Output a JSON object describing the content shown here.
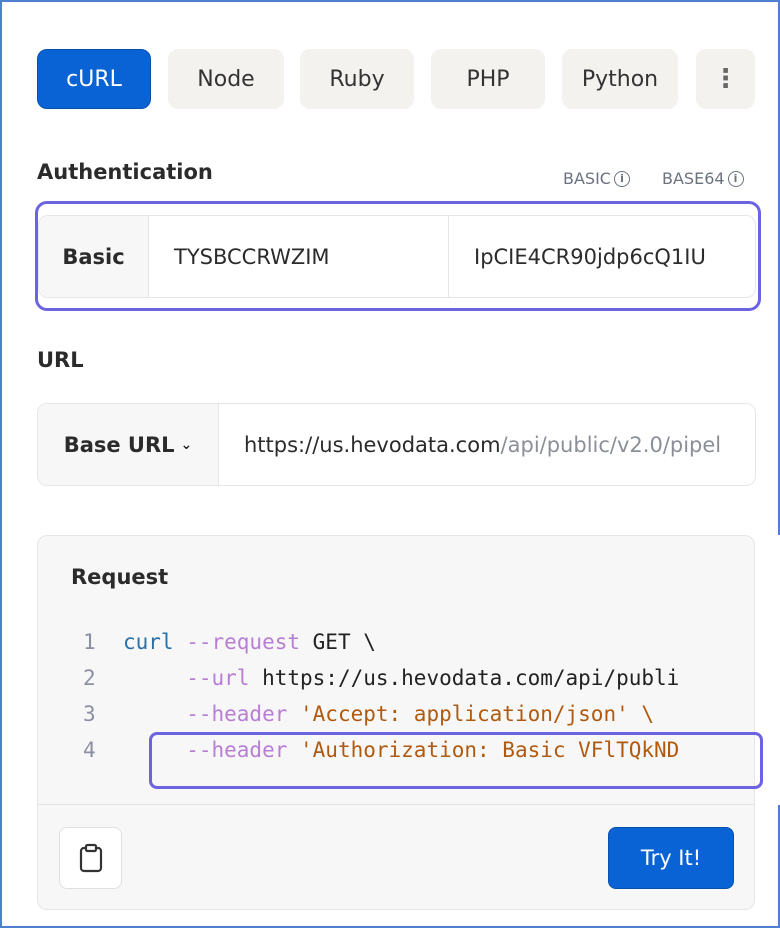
{
  "tabs": [
    "cURL",
    "Node",
    "Ruby",
    "PHP",
    "Python"
  ],
  "more_icon": "kebab-vertical-icon",
  "auth": {
    "title": "Authentication",
    "basic_label": "BASIC",
    "base64_label": "BASE64",
    "type": "Basic",
    "username": "TYSBCCRWZIM",
    "password": "IpCIE4CR90jdp6cQ1IU"
  },
  "url": {
    "title": "URL",
    "label": "Base URL",
    "base": "https://us.hevodata.com",
    "path": "/api/public/v2.0/pipel"
  },
  "request": {
    "title": "Request",
    "lines": [
      {
        "n": "1",
        "a": "curl",
        "b": " --request",
        "c": " GET \\",
        "d": ""
      },
      {
        "n": "2",
        "a": "",
        "b": "     --url",
        "c": " https://us.hevodata.com/api/publi",
        "d": ""
      },
      {
        "n": "3",
        "a": "",
        "b": "     --header",
        "c": "",
        "d": " 'Accept: application/json' \\"
      },
      {
        "n": "4",
        "a": "",
        "b": "     --header",
        "c": "",
        "d": " 'Authorization: Basic VFlTQkND"
      }
    ]
  },
  "try_label": "Try It!",
  "colors": {
    "accent": "#0a63d4",
    "highlight": "#6b63e0"
  }
}
